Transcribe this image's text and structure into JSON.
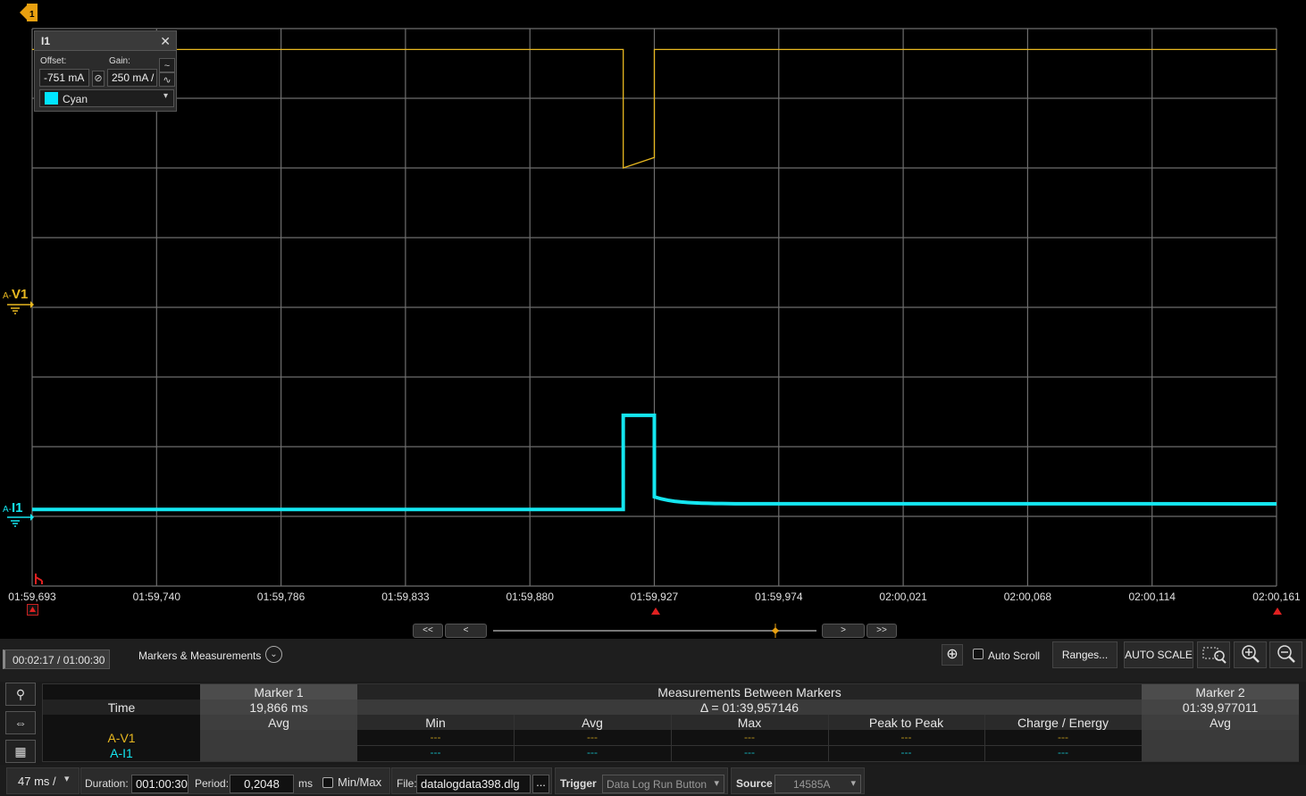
{
  "channel_popup": {
    "name": "I1",
    "offset_label": "Offset:",
    "offset_value": "-751 mA",
    "gain_label": "Gain:",
    "gain_value": "250 mA /",
    "color_name": "Cyan",
    "color_swatch": "#00e5ff"
  },
  "channels": {
    "v1": {
      "prefix": "A-",
      "name": "V1",
      "color": "#e8b820"
    },
    "i1": {
      "prefix": "A-",
      "name": "I1",
      "color": "#14e6f0"
    }
  },
  "time_axis": {
    "ticks": [
      "01:59,693",
      "01:59,740",
      "01:59,786",
      "01:59,833",
      "01:59,880",
      "01:59,927",
      "01:59,974",
      "02:00,021",
      "02:00,068",
      "02:00,114",
      "02:00,161"
    ]
  },
  "waveforms": {
    "v1": {
      "baseline_div": 0.3,
      "dip_div": 2.0,
      "dip_end_div": 1.85,
      "dip_start_t": 4.75,
      "dip_end_t": 5.0
    },
    "i1": {
      "baseline_div": 6.9,
      "peak_div": 5.55,
      "settle_div": 6.82,
      "pulse_start_t": 4.75,
      "pulse_end_t": 5.0,
      "settle_t": 5.65
    }
  },
  "nav": {
    "first": "<<",
    "prev": "<",
    "next": ">",
    "last": ">>"
  },
  "toolbar": {
    "position_readout": "00:02:17 / 01:00:30",
    "markers_label": "Markers & Measurements",
    "auto_scroll": "Auto Scroll",
    "ranges": "Ranges...",
    "auto_scale": "AUTO SCALE"
  },
  "measurements": {
    "marker1_header": "Marker 1",
    "between_header": "Measurements Between Markers",
    "marker2_header": "Marker 2",
    "time_label": "Time",
    "marker1_time": "19,866 ms",
    "delta": "Δ = 01:39,957146",
    "marker2_time": "01:39,977011",
    "cols": [
      "Avg",
      "Min",
      "Avg",
      "Max",
      "Peak to Peak",
      "Charge / Energy",
      "Avg"
    ],
    "rows": [
      {
        "label": "A-V1",
        "color": "#e8b820",
        "values": [
          "---",
          "---",
          "---",
          "---",
          "---"
        ]
      },
      {
        "label": "A-I1",
        "color": "#14e6f0",
        "values": [
          "---",
          "---",
          "---",
          "---",
          "---"
        ]
      }
    ]
  },
  "bottom": {
    "timebase": "47 ms /",
    "duration_label": "Duration:",
    "duration_value": "001:00:30",
    "period_label": "Period:",
    "period_value": "0,2048",
    "period_unit": "ms",
    "minmax": "Min/Max",
    "file_label": "File:",
    "file_value": "datalogdata398.dlg",
    "browse": "...",
    "trigger_label": "Trigger",
    "trigger_value": "Data Log Run Button",
    "source_label": "Source",
    "source_value": "14585A"
  }
}
